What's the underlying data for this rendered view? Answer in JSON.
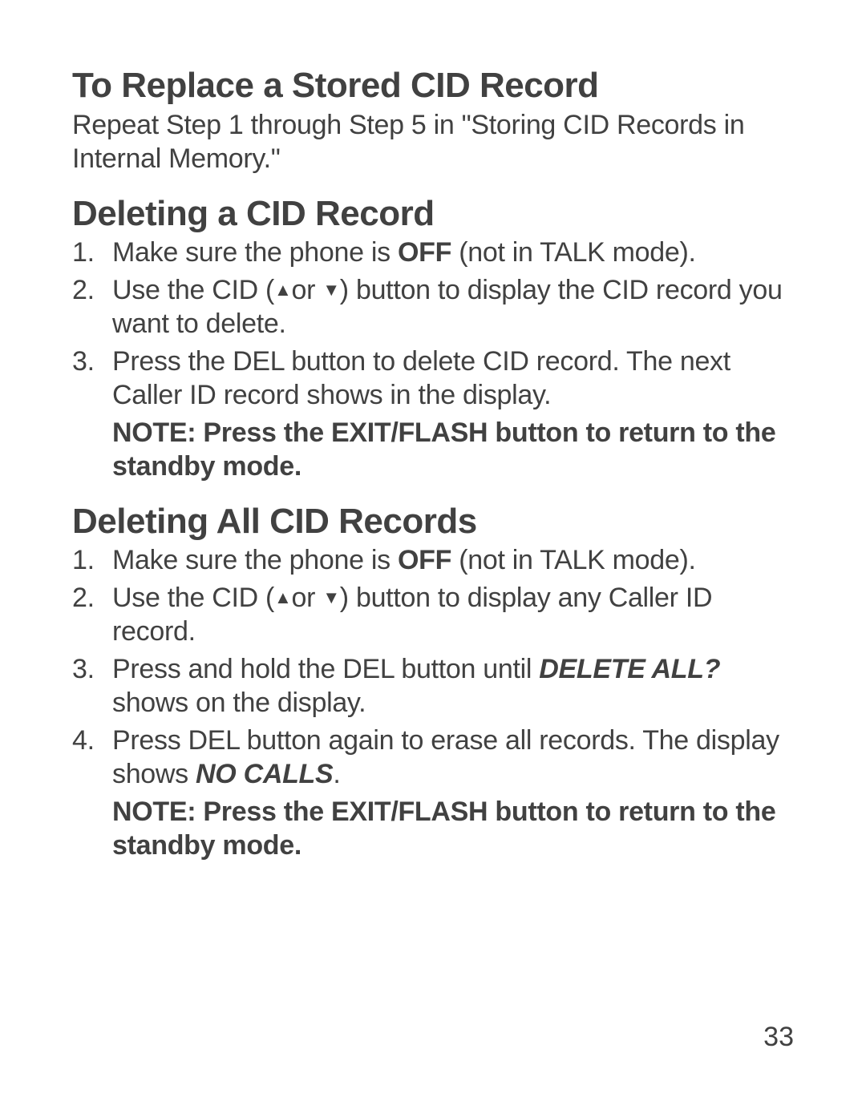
{
  "section1": {
    "heading": "To Replace a Stored CID Record",
    "body": "Repeat Step 1 through Step 5 in \"Storing CID Records in Internal Memory.\""
  },
  "section2": {
    "heading": "Deleting a CID Record",
    "step1_a": "Make sure the phone is ",
    "step1_off": "OFF",
    "step1_b": " (not in TALK mode).",
    "step2_a": "Use the  CID (",
    "tri_up": "▲",
    "step2_or": "or ",
    "tri_dn": "▼",
    "step2_b": ") button to display the CID record you want to delete.",
    "step3": "Press the DEL button to delete CID record. The next Caller ID record shows in the display.",
    "note": "NOTE: Press the EXIT/FLASH button to return to the standby mode."
  },
  "section3": {
    "heading": "Deleting All CID Records",
    "step1_a": "Make sure the phone is ",
    "step1_off": "OFF",
    "step1_b": " (not in TALK mode).",
    "step2_a": "Use the  CID (",
    "tri_up": "▲",
    "step2_or": "or ",
    "tri_dn": "▼",
    "step2_b": ") button to display any Caller ID record.",
    "step3_a": "Press and hold the DEL button until ",
    "step3_em": "DELETE ALL?",
    "step3_b": " shows on the display.",
    "step4_a": "Press DEL button again to erase all records. The display shows ",
    "step4_em": "NO CALLS",
    "step4_b": ".",
    "note": "NOTE: Press the EXIT/FLASH button to return to the standby mode."
  },
  "page_number": "33"
}
